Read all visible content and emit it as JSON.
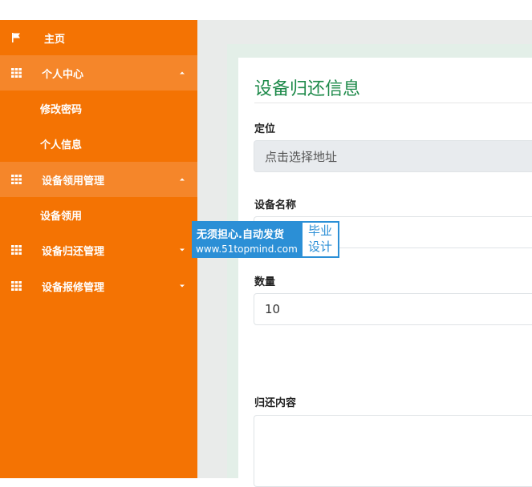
{
  "sidebar": {
    "items": [
      {
        "label": "主页",
        "icon": "flag-icon"
      },
      {
        "label": "个人中心",
        "icon": "grid-icon",
        "expanded": true
      },
      {
        "label": "修改密码"
      },
      {
        "label": "个人信息"
      },
      {
        "label": "设备领用管理",
        "icon": "grid-icon",
        "expanded": true
      },
      {
        "label": "设备领用"
      },
      {
        "label": "设备归还管理",
        "icon": "grid-icon",
        "expanded": false
      },
      {
        "label": "设备报修管理",
        "icon": "grid-icon",
        "expanded": false
      }
    ]
  },
  "form": {
    "title": "设备归还信息",
    "location_label": "定位",
    "location_value": "点击选择地址",
    "device_name_label": "设备名称",
    "device_name_value": "",
    "quantity_label": "数量",
    "quantity_value": "10",
    "return_content_label": "归还内容",
    "return_content_value": ""
  },
  "watermark": {
    "line1": "无须担心.自动发货",
    "line2": "www.51topmind.com",
    "badge_line1": "毕业",
    "badge_line2": "设计"
  },
  "colors": {
    "sidebar_bg": "#f47303",
    "sidebar_active": "#f5862a",
    "title_green": "#1e8a4a",
    "watermark_blue": "#2b8fd6"
  }
}
